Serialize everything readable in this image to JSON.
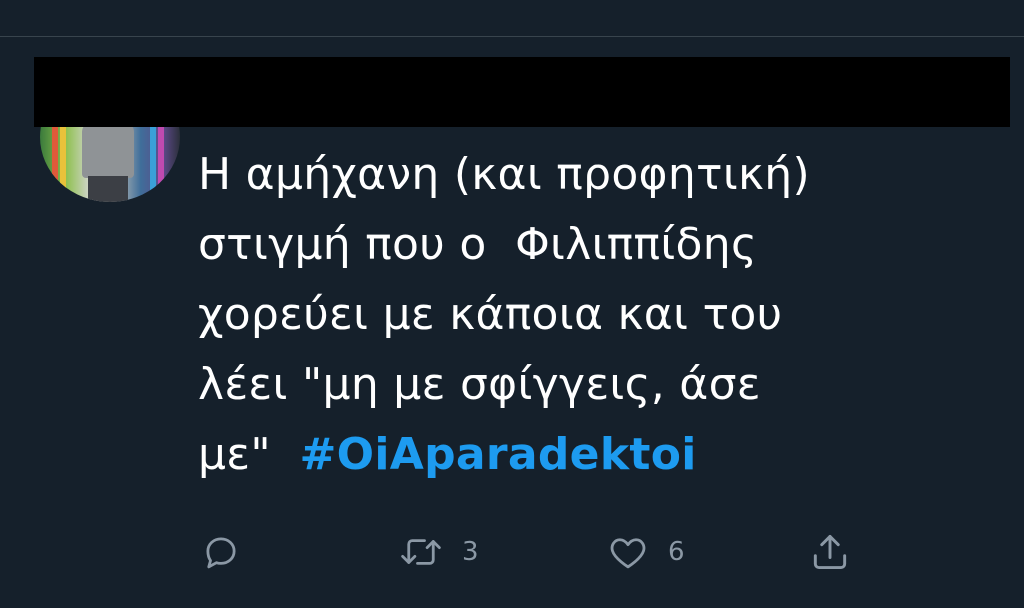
{
  "tweet": {
    "text": "Η αμήχανη (και προφητική) στιγμή που ο  Φιλιππίδης χορεύει με κάποια και του λέει \"μη με σφίγγεις, άσε με\"",
    "text_lines": [
      "Η αμήχανη (και προφητική)",
      "στιγμή που ο  Φιλιππίδης",
      "χορεύει με κάποια και του",
      "λέει \"μη με σφίγγεις, άσε",
      "με\"  "
    ],
    "hashtag": "#OiAparadektoi"
  },
  "actions": {
    "reply": {
      "icon": "reply-icon",
      "count": ""
    },
    "retweet": {
      "icon": "retweet-icon",
      "count": "3"
    },
    "like": {
      "icon": "heart-icon",
      "count": "6"
    },
    "share": {
      "icon": "share-icon",
      "count": ""
    }
  },
  "colors": {
    "background": "#15202b",
    "text": "#ffffff",
    "muted": "#8b98a5",
    "accent": "#1d9bf0",
    "redaction": "#000000"
  }
}
